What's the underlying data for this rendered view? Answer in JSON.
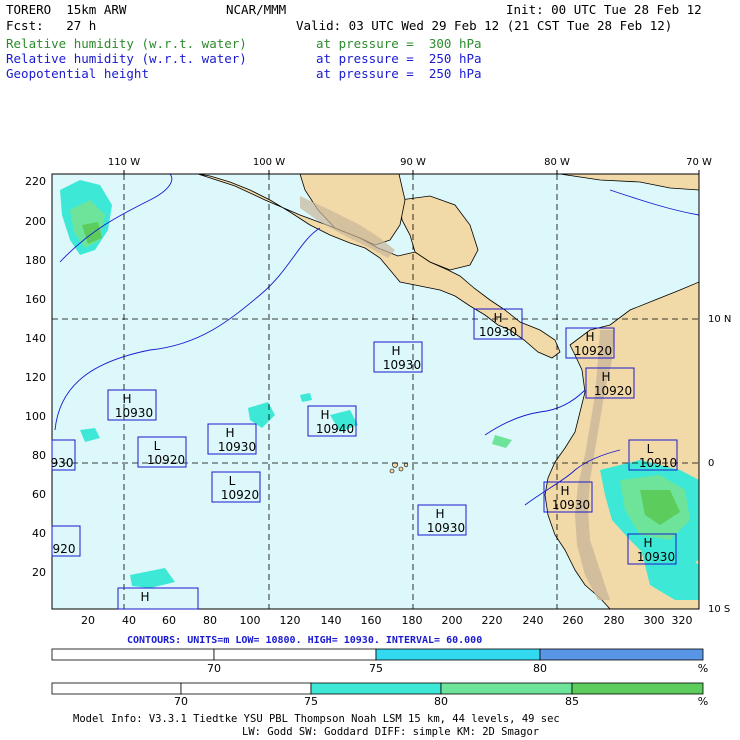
{
  "header": {
    "model": "TORERO  15km ARW",
    "center": "NCAR/MMM",
    "init": "Init: 00 UTC Tue 28 Feb 12",
    "fcst": "Fcst:   27 h",
    "valid": "Valid: 03 UTC Wed 29 Feb 12 (21 CST Tue 28 Feb 12)",
    "fields": [
      {
        "name": "Relative humidity (w.r.t. water)",
        "level": "at pressure =  300 hPa",
        "color": "#2e8b2e"
      },
      {
        "name": "Relative humidity (w.r.t. water)",
        "level": "at pressure =  250 hPa",
        "color": "#1a1ad0"
      },
      {
        "name": "Geopotential height",
        "level": "at pressure =  250 hPa",
        "color": "#1a1ad0"
      }
    ]
  },
  "map": {
    "top_lon_labels": [
      "110 W",
      "100 W",
      "90 W",
      "80 W",
      "70 W"
    ],
    "right_lat_labels": [
      "10 N",
      "0",
      "10 S"
    ],
    "x_ticks": [
      "20",
      "40",
      "60",
      "80",
      "100",
      "120",
      "140",
      "160",
      "180",
      "200",
      "220",
      "240",
      "260",
      "280",
      "300",
      "320"
    ],
    "y_ticks": [
      "220",
      "200",
      "180",
      "160",
      "140",
      "120",
      "100",
      "80",
      "60",
      "40",
      "20"
    ],
    "ocean_color": "#dcf8fa",
    "land_color": "#f2d9a8",
    "highs_lows": [
      {
        "type": "H",
        "value": "10930"
      },
      {
        "type": "H",
        "value": "10920"
      },
      {
        "type": "H",
        "value": "10930"
      },
      {
        "type": "H",
        "value": "10920"
      },
      {
        "type": "H",
        "value": "10930"
      },
      {
        "type": "H",
        "value": "10940"
      },
      {
        "type": "L",
        "value": "10920"
      },
      {
        "type": "H",
        "value": "10930"
      },
      {
        "type": "L",
        "value": "10910"
      },
      {
        "type": "L",
        "value": "10920"
      },
      {
        "type": "H",
        "value": "10930"
      },
      {
        "type": "H",
        "value": "10930"
      },
      {
        "type": "H",
        "value": "10930"
      },
      {
        "type": "",
        "value": "930"
      },
      {
        "type": "",
        "value": "920"
      },
      {
        "type": "H",
        "value": ""
      }
    ]
  },
  "contour_info": "CONTOURS:  UNITS=m  LOW=  10800.       HIGH=  10930.      INTERVAL=   60.000",
  "colorbar1": {
    "labels": [
      "70",
      "75",
      "80",
      "%"
    ],
    "colors": [
      "#ffffff",
      "#ffffff",
      "#33d9ee",
      "#5a96e6"
    ]
  },
  "colorbar2": {
    "labels": [
      "70",
      "75",
      "80",
      "85",
      "%"
    ],
    "colors": [
      "#ffffff",
      "#ffffff",
      "#3ee8d6",
      "#6ee49a",
      "#5ccd5c"
    ]
  },
  "footer": {
    "line1": "Model Info: V3.3.1   Tiedtke YSU PBL  Thompson    Noah LSM  15 km,   44 levels,   49 sec",
    "line2": "LW: Godd SW: Goddard DIFF: simple KM: 2D Smagor"
  }
}
